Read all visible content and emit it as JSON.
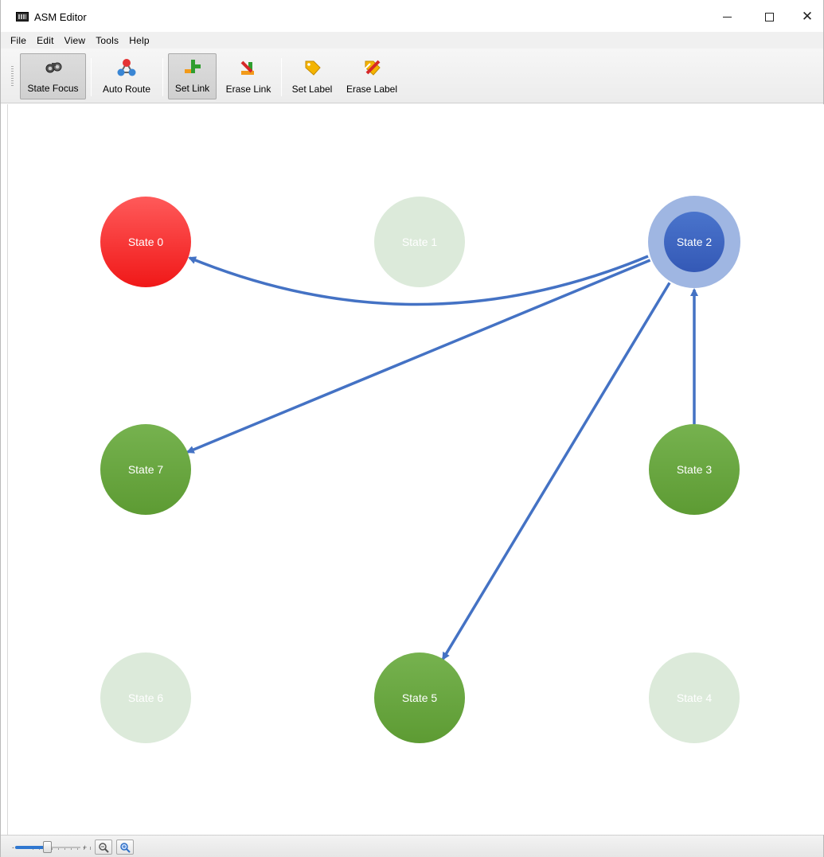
{
  "window": {
    "title": "ASM Editor",
    "minimize_label": "Minimize",
    "maximize_label": "Maximize",
    "close_glyph": "✕"
  },
  "menu": [
    "File",
    "Edit",
    "View",
    "Tools",
    "Help"
  ],
  "toolbar": {
    "buttons": [
      {
        "label": "State Focus",
        "icon": "binoculars-icon",
        "pressed": true
      },
      {
        "label": "Auto Route",
        "icon": "network-nodes-icon",
        "pressed": false
      },
      {
        "label": "Set Link",
        "icon": "pipe-link-icon",
        "pressed": true
      },
      {
        "label": "Erase Link",
        "icon": "erase-link-icon",
        "pressed": false
      },
      {
        "label": "Set Label",
        "icon": "tag-icon",
        "pressed": false
      },
      {
        "label": "Erase Label",
        "icon": "erase-tag-icon",
        "pressed": false
      }
    ]
  },
  "graph": {
    "states": [
      {
        "id": 0,
        "label": "State 0",
        "status": "initial",
        "color": "#ff2a2a"
      },
      {
        "id": 1,
        "label": "State 1",
        "status": "faded",
        "color": "#dceada"
      },
      {
        "id": 2,
        "label": "State 2",
        "status": "focused",
        "color": "#3d67c3"
      },
      {
        "id": 3,
        "label": "State 3",
        "status": "active",
        "color": "#64a33c"
      },
      {
        "id": 4,
        "label": "State 4",
        "status": "faded",
        "color": "#dceada"
      },
      {
        "id": 5,
        "label": "State 5",
        "status": "active",
        "color": "#64a33c"
      },
      {
        "id": 6,
        "label": "State 6",
        "status": "faded",
        "color": "#dceada"
      },
      {
        "id": 7,
        "label": "State 7",
        "status": "active",
        "color": "#64a33c"
      }
    ],
    "links": [
      {
        "from": 2,
        "to": 0
      },
      {
        "from": 2,
        "to": 7
      },
      {
        "from": 2,
        "to": 5
      },
      {
        "from": 3,
        "to": 2
      }
    ],
    "link_color": "#4472c4",
    "focus_ring_color": "#9fb6e2"
  },
  "statusbar": {
    "zoom_level": 0.5,
    "zoom_out_icon": "zoom-out-icon",
    "zoom_in_icon": "zoom-in-icon"
  }
}
